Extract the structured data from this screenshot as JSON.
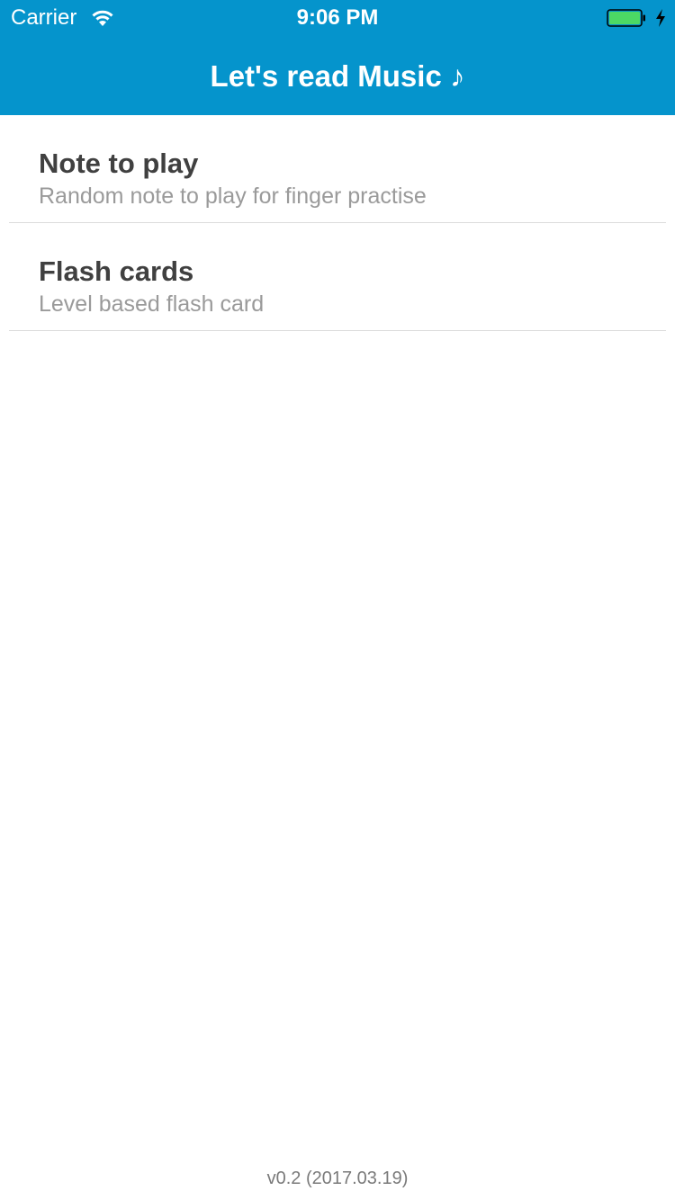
{
  "status_bar": {
    "carrier": "Carrier",
    "time": "9:06 PM",
    "wifi_icon": "wifi-icon",
    "battery_icon": "battery-icon",
    "battery_level": 1.0,
    "charging_icon": "bolt-icon"
  },
  "nav": {
    "title": "Let's read Music ♪"
  },
  "menu": {
    "items": [
      {
        "title": "Note to play",
        "subtitle": "Random note to play for finger practise"
      },
      {
        "title": "Flash cards",
        "subtitle": "Level based flash card"
      }
    ]
  },
  "footer": {
    "version": "v0.2 (2017.03.19)"
  },
  "colors": {
    "header_bg": "#0594cc",
    "title_text": "#404040",
    "subtitle_text": "#9a9a9a",
    "battery_fill": "#4cd964"
  }
}
